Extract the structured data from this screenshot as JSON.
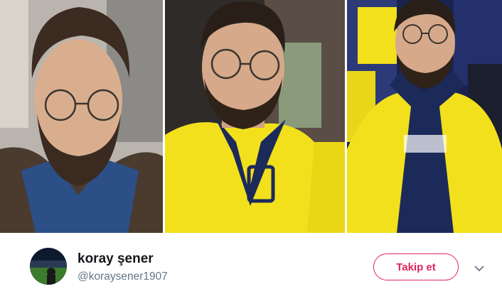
{
  "tweet": {
    "author": {
      "display_name": "koray şener",
      "handle": "@koraysener1907"
    },
    "follow_button_label": "Takip et",
    "menu_icon": "chevron-down-icon",
    "text_preview": ""
  },
  "photos": [
    {
      "description_icon": "photo-1"
    },
    {
      "description_icon": "photo-2"
    },
    {
      "description_icon": "photo-3"
    }
  ],
  "colors": {
    "accent": "#e0245e",
    "name": "#14171a",
    "handle": "#657786",
    "jersey_yellow": "#f2e01c",
    "jersey_navy": "#1c2a5a"
  }
}
